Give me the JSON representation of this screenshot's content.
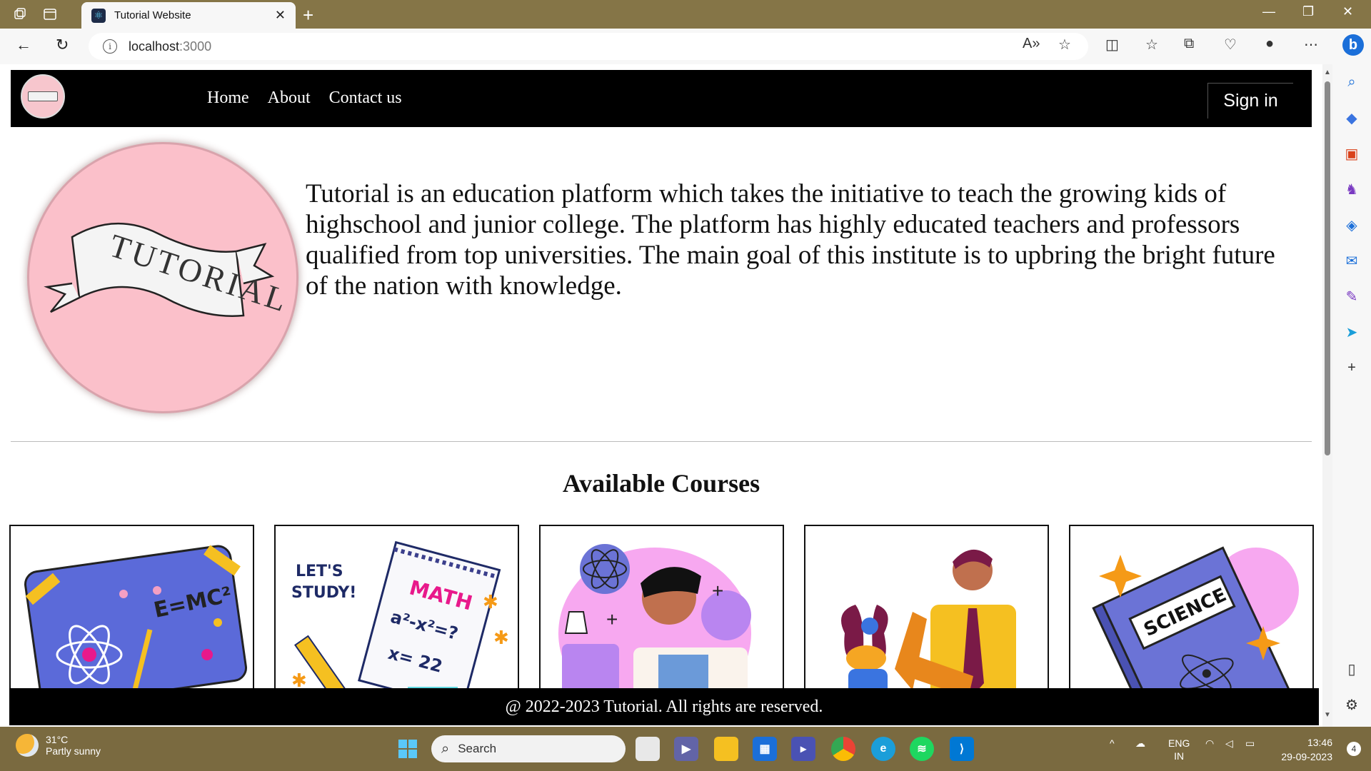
{
  "browser": {
    "tab_title": "Tutorial Website",
    "url_host": "localhost",
    "url_port": ":3000",
    "new_tab_symbol": "+",
    "close_symbol": "✕"
  },
  "site": {
    "nav": [
      "Home",
      "About",
      "Contact us"
    ],
    "signin_label": "Sign in",
    "logo_text": "TUTORIAL",
    "description": "Tutorial is an education platform which takes the initiative to teach the growing kids of highschool and junior college. The platform has highly educated teachers and professors qualified from top universities. The main goal of this institute is to upbring the bright future of the nation with knowledge.",
    "courses_heading": "Available Courses",
    "courses": [
      {
        "icon": "physics-board-illustration",
        "text": "E=MC²"
      },
      {
        "icon": "math-notebook-illustration",
        "text_a": "LET'S",
        "text_b": "STUDY!",
        "text_c": "MATH",
        "text_d": "a²-x²=?",
        "text_e": "x= 22"
      },
      {
        "icon": "chemistry-scientist-illustration"
      },
      {
        "icon": "biology-student-illustration"
      },
      {
        "icon": "science-book-illustration",
        "text": "SCIENCE"
      }
    ],
    "footer": "@ 2022-2023 Tutorial. All rights are reserved."
  },
  "taskbar": {
    "weather_temp": "31°C",
    "weather_cond": "Partly sunny",
    "search_placeholder": "Search",
    "lang_top": "ENG",
    "lang_bottom": "IN",
    "time": "13:46",
    "date": "29-09-2023",
    "notifications": "4"
  },
  "colors": {
    "titlebar": "#857547",
    "taskbar": "#7a6a40",
    "hero_circle": "#fbc0ca",
    "navbar": "#000000"
  }
}
